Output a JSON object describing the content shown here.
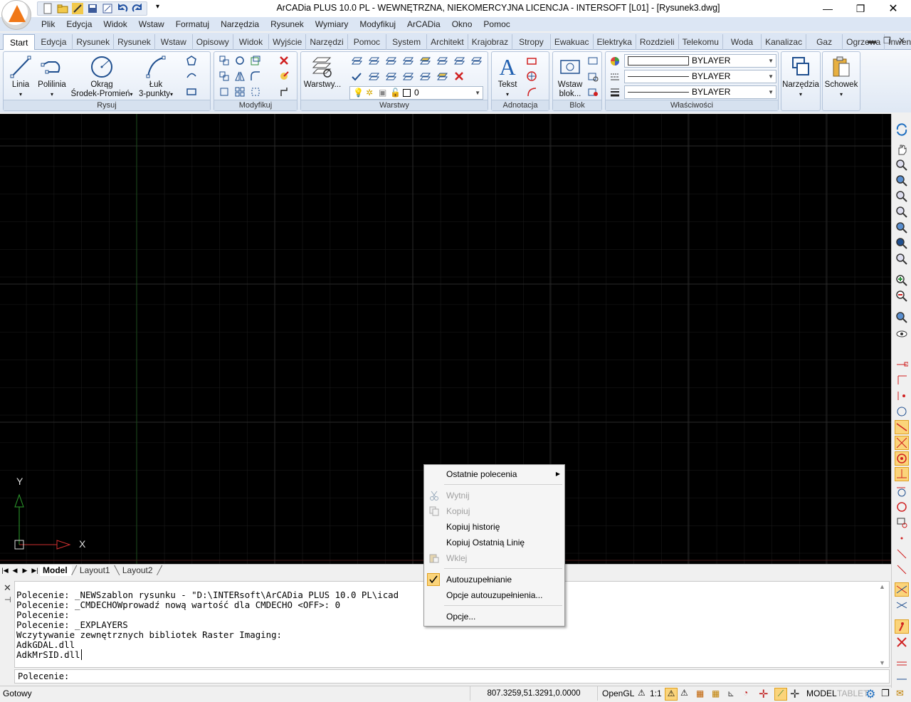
{
  "app": {
    "title": "ArCADia PLUS 10.0 PL - WEWNĘTRZNA, NIEKOMERCYJNA LICENCJA - INTERSOFT [L01] - [Rysunek3.dwg]"
  },
  "menubar": [
    "Plik",
    "Edycja",
    "Widok",
    "Wstaw",
    "Formatuj",
    "Narzędzia",
    "Rysunek",
    "Wymiary",
    "Modyfikuj",
    "ArCADia",
    "Okno",
    "Pomoc"
  ],
  "ribbon_tabs": [
    "Start",
    "Edycja",
    "Rysunek",
    "Rysunek",
    "Wstaw",
    "Opisowy",
    "Widok",
    "Wyjście",
    "Narzędzi",
    "Pomoc",
    "System",
    "Architekt",
    "Krajobraz",
    "Stropy",
    "Ewakuac",
    "Elektryka",
    "Rozdzieli",
    "Telekomu",
    "Woda",
    "Kanalizac",
    "Gaz",
    "Ogrzewa",
    "Inwentar"
  ],
  "ribbon": {
    "rysuj": {
      "label": "Rysuj",
      "linia": "Linia",
      "polilinia": "Polilinia",
      "okrag": "Okrąg",
      "okrag_sub": "Środek-Promień",
      "luk": "Łuk",
      "luk_sub": "3-punkty"
    },
    "modyfikuj": {
      "label": "Modyfikuj"
    },
    "warstwy": {
      "label": "Warstwy",
      "button": "Warstwy...",
      "layer_value": "0"
    },
    "adnotacja": {
      "label": "Adnotacja",
      "tekst": "Tekst"
    },
    "blok": {
      "label": "Blok",
      "wstaw": "Wstaw",
      "wstaw_sub": "blok..."
    },
    "wlasciwosci": {
      "label": "Właściwości",
      "color": "BYLAYER",
      "linetype": "BYLAYER",
      "lineweight": "BYLAYER"
    },
    "narzedzia": "Narzędzia",
    "schowek": "Schowek"
  },
  "ucs": {
    "y": "Y",
    "x": "X"
  },
  "layout_tabs": [
    "Model",
    "Layout1",
    "Layout2"
  ],
  "command_log": [
    "Polecenie: _NEWSzablon rysunku - \"D:\\INTERsoft\\ArCADia PLUS 10.0 PL\\icad",
    "Polecenie: _CMDECHOWprowadź nową wartość dla CMDECHO <OFF>: 0",
    "Polecenie:",
    "Polecenie: _EXPLAYERS",
    "Wczytywanie zewnętrznych bibliotek Raster Imaging:",
    "AdkGDAL.dll",
    "AdkMrSID.dll"
  ],
  "command_prompt": "Polecenie:",
  "context_menu": {
    "recent": "Ostatnie polecenia",
    "cut": "Wytnij",
    "copy": "Kopiuj",
    "copy_history": "Kopiuj historię",
    "copy_last_line": "Kopiuj Ostatnią Linię",
    "paste": "Wklej",
    "autocomplete": "Autouzupełnianie",
    "autocomplete_options": "Opcje autouzupełnienia...",
    "options": "Opcje..."
  },
  "statusbar": {
    "status": "Gotowy",
    "coords": "807.3259,51.3291,0.0000",
    "opengl": "OpenGL",
    "scale": "1:1",
    "model": "MODEL",
    "tablet": "TABLET"
  },
  "colors": {
    "accent": "#f07818",
    "canvas": "#000000",
    "grid": "#1c1c1c",
    "ribbon_bg": "#dce6f4"
  }
}
